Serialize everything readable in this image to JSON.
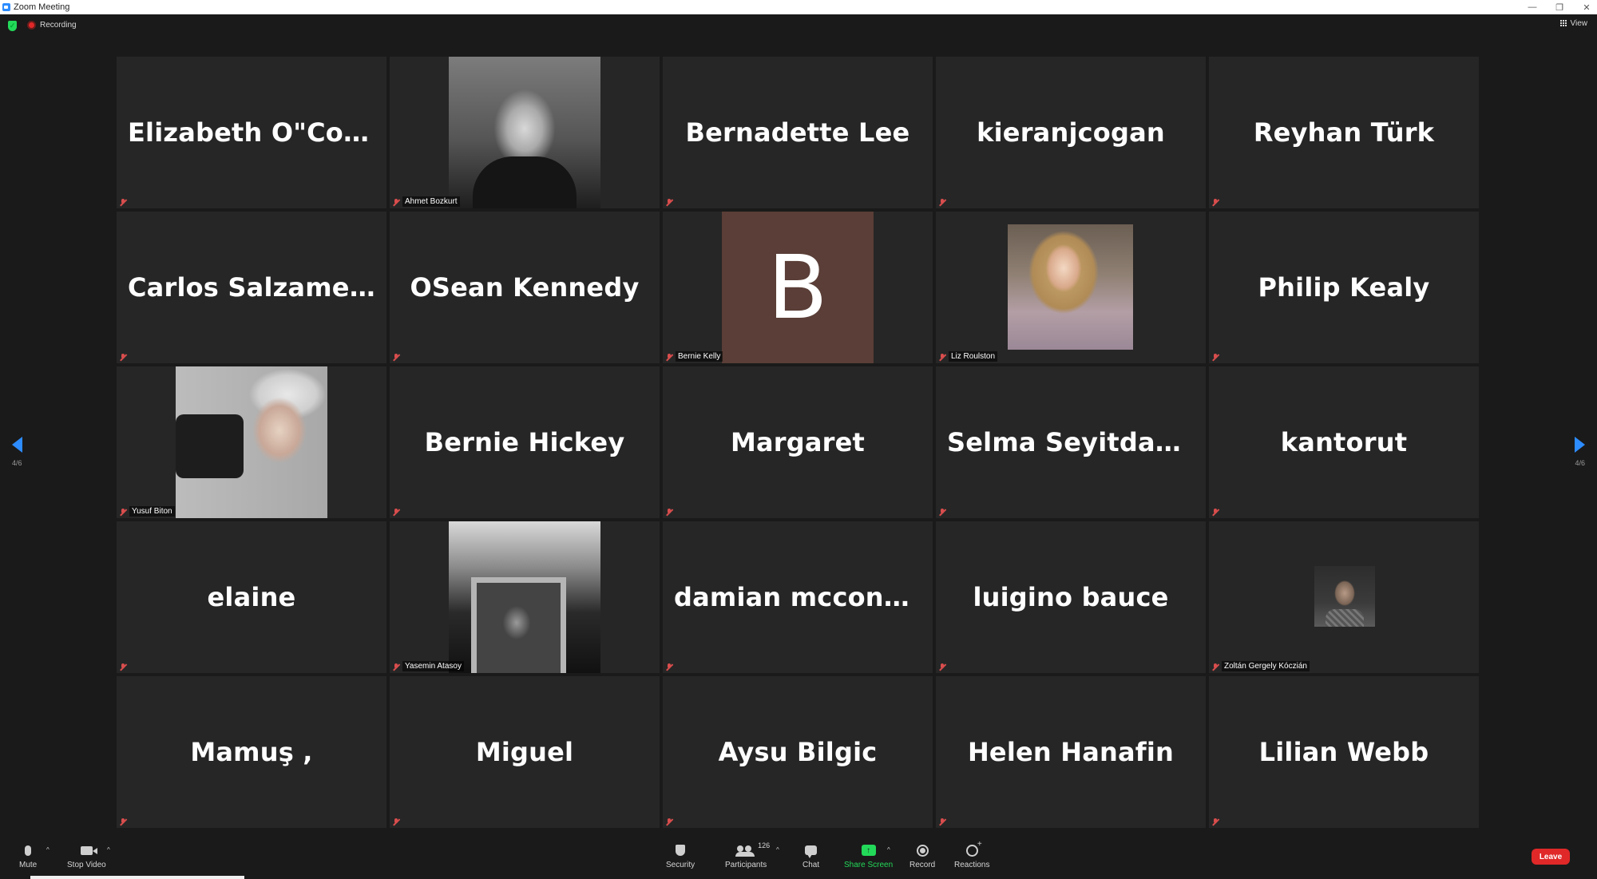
{
  "window": {
    "title": "Zoom Meeting",
    "minimize": "—",
    "restore": "❐",
    "close": "✕"
  },
  "topbar": {
    "recording_label": "Recording",
    "view_label": "View"
  },
  "navigation": {
    "page_indicator_left": "4/6",
    "page_indicator_right": "4/6"
  },
  "participants": [
    {
      "display": "Elizabeth  O\"Con...",
      "video": "off"
    },
    {
      "display": "",
      "label": "Ahmet Bozkurt",
      "video": "photo"
    },
    {
      "display": "Bernadette Lee",
      "video": "off"
    },
    {
      "display": "kieranjcogan",
      "video": "off"
    },
    {
      "display": "Reyhan Türk",
      "video": "off"
    },
    {
      "display": "Carlos Salzamendi",
      "video": "off"
    },
    {
      "display": "OSean Kennedy",
      "video": "off"
    },
    {
      "display": "B",
      "label": "Bernie Kelly",
      "video": "letter"
    },
    {
      "display": "",
      "label": "Liz Roulston",
      "video": "photo"
    },
    {
      "display": "Philip Kealy",
      "video": "off"
    },
    {
      "display": "",
      "label": "Yusuf Biton",
      "video": "photo"
    },
    {
      "display": "Bernie Hickey",
      "video": "off"
    },
    {
      "display": "Margaret",
      "video": "off"
    },
    {
      "display": "Selma  Seyitdanl...",
      "video": "off"
    },
    {
      "display": "kantorut",
      "video": "off"
    },
    {
      "display": "elaine",
      "video": "off"
    },
    {
      "display": "",
      "label": "Yasemin Atasoy",
      "video": "photo"
    },
    {
      "display": "damian  mcconvi...",
      "video": "off"
    },
    {
      "display": "luigino bauce",
      "video": "off"
    },
    {
      "display": "",
      "label": "Zoltán Gergely Kóczián",
      "video": "photo"
    },
    {
      "display": "Mamuş ,",
      "video": "off"
    },
    {
      "display": "Miguel",
      "video": "off"
    },
    {
      "display": "Aysu Bilgic",
      "video": "off"
    },
    {
      "display": "Helen Hanafin",
      "video": "off"
    },
    {
      "display": "Lilian Webb",
      "video": "off"
    }
  ],
  "toolbar": {
    "mute": "Mute",
    "stop_video": "Stop Video",
    "security": "Security",
    "participants": "Participants",
    "participant_count": "126",
    "chat": "Chat",
    "share_screen": "Share Screen",
    "record": "Record",
    "reactions": "Reactions",
    "leave": "Leave"
  },
  "colors": {
    "accent": "#2d8cff",
    "share_green": "#23d959",
    "leave_red": "#e02828",
    "tile_bg": "#262626",
    "muted_mic": "#d94d4d"
  },
  "icons": [
    "zoom-app-icon",
    "encryption-shield-icon",
    "recording-icon",
    "gallery-view-icon",
    "muted-mic-icon",
    "prev-page-arrow-icon",
    "next-page-arrow-icon",
    "mic-icon",
    "video-camera-icon",
    "security-shield-icon",
    "participants-icon",
    "chat-icon",
    "share-screen-icon",
    "record-icon",
    "reactions-icon"
  ]
}
